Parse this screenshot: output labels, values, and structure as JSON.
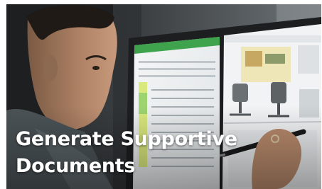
{
  "tile": {
    "title_line1": "Generate Supportive",
    "title_line2": "Documents"
  },
  "photo": {
    "subject": "man-pointing-stylus-at-touch-screen-icon"
  },
  "colors": {
    "caption_text": "#ffffff",
    "accent_green": "#3fa34d",
    "highlight_yellow": "#d7e86a"
  }
}
